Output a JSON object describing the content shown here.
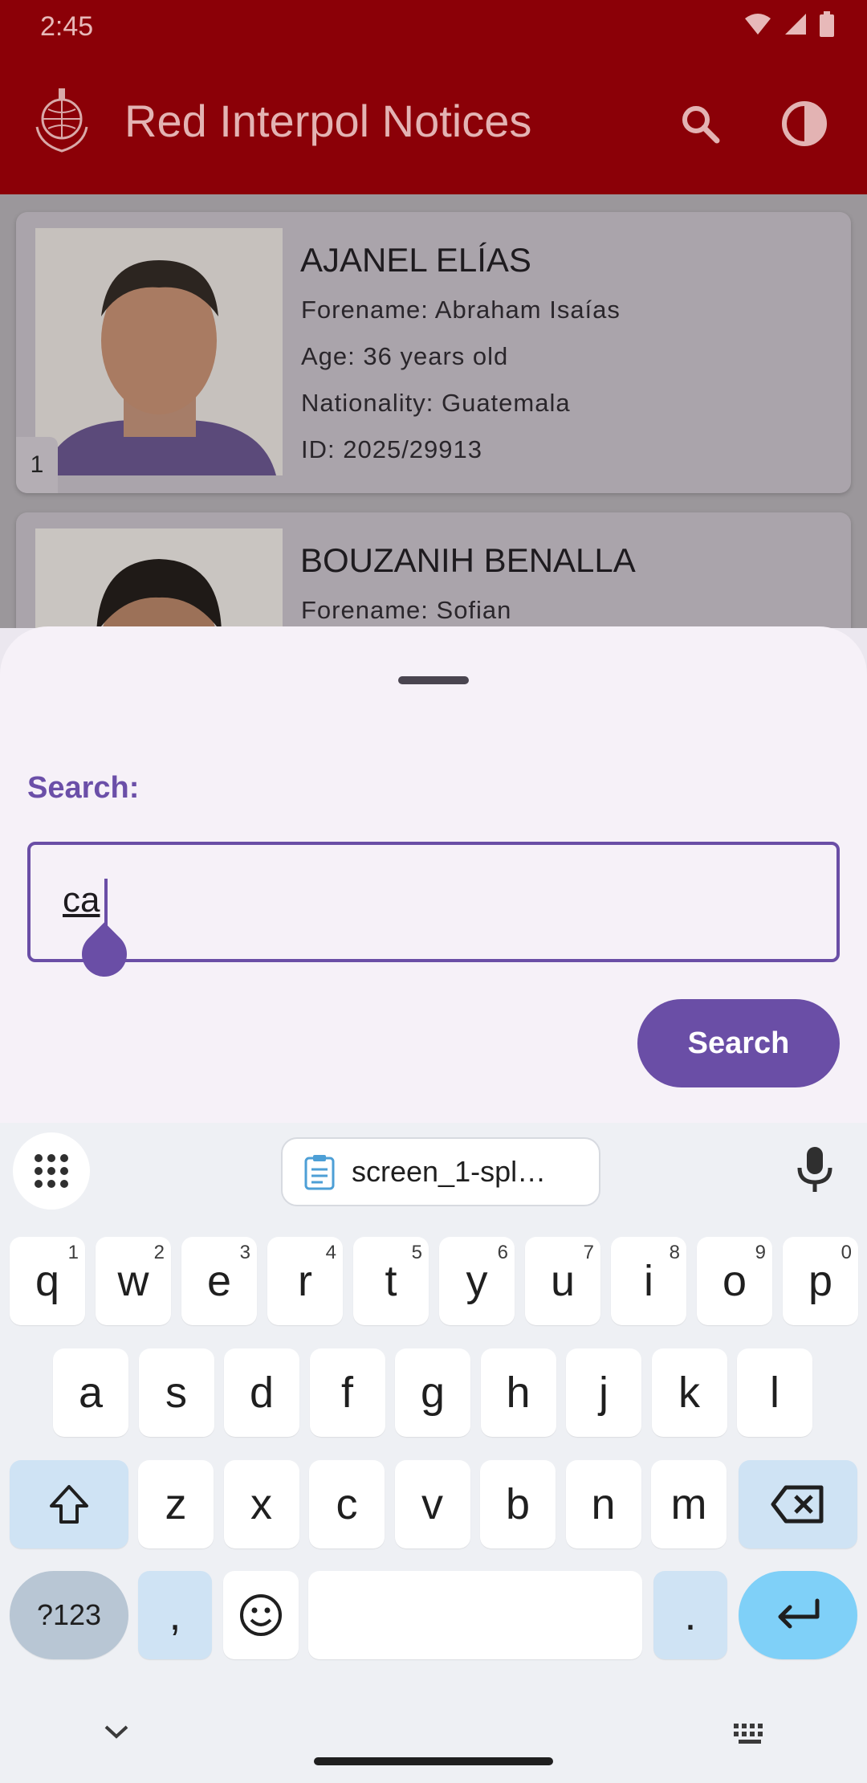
{
  "status_bar": {
    "time": "2:45"
  },
  "app_bar": {
    "title": "Red Interpol Notices",
    "search_icon": "search-icon",
    "theme_icon": "contrast-icon",
    "color": "#8b0007"
  },
  "notices": [
    {
      "index": "1",
      "name": "AJANEL ELÍAS",
      "forename": "Forename: Abraham Isaías",
      "age": "Age: 36 years old",
      "nationality": "Nationality: Guatemala",
      "id": "ID: 2025/29913"
    },
    {
      "name": "BOUZANIH BENALLA",
      "forename": "Forename: Sofian"
    }
  ],
  "search_sheet": {
    "label": "Search:",
    "input_value": "ca",
    "button_label": "Search",
    "accent": "#6a4ea6"
  },
  "keyboard": {
    "clipboard_suggestion": "screen_1-spl…",
    "row1": [
      {
        "k": "q",
        "h": "1"
      },
      {
        "k": "w",
        "h": "2"
      },
      {
        "k": "e",
        "h": "3"
      },
      {
        "k": "r",
        "h": "4"
      },
      {
        "k": "t",
        "h": "5"
      },
      {
        "k": "y",
        "h": "6"
      },
      {
        "k": "u",
        "h": "7"
      },
      {
        "k": "i",
        "h": "8"
      },
      {
        "k": "o",
        "h": "9"
      },
      {
        "k": "p",
        "h": "0"
      }
    ],
    "row2": [
      "a",
      "s",
      "d",
      "f",
      "g",
      "h",
      "j",
      "k",
      "l"
    ],
    "row3": [
      "z",
      "x",
      "c",
      "v",
      "b",
      "n",
      "m"
    ],
    "sym_label": "?123",
    "comma": ",",
    "period": "."
  }
}
